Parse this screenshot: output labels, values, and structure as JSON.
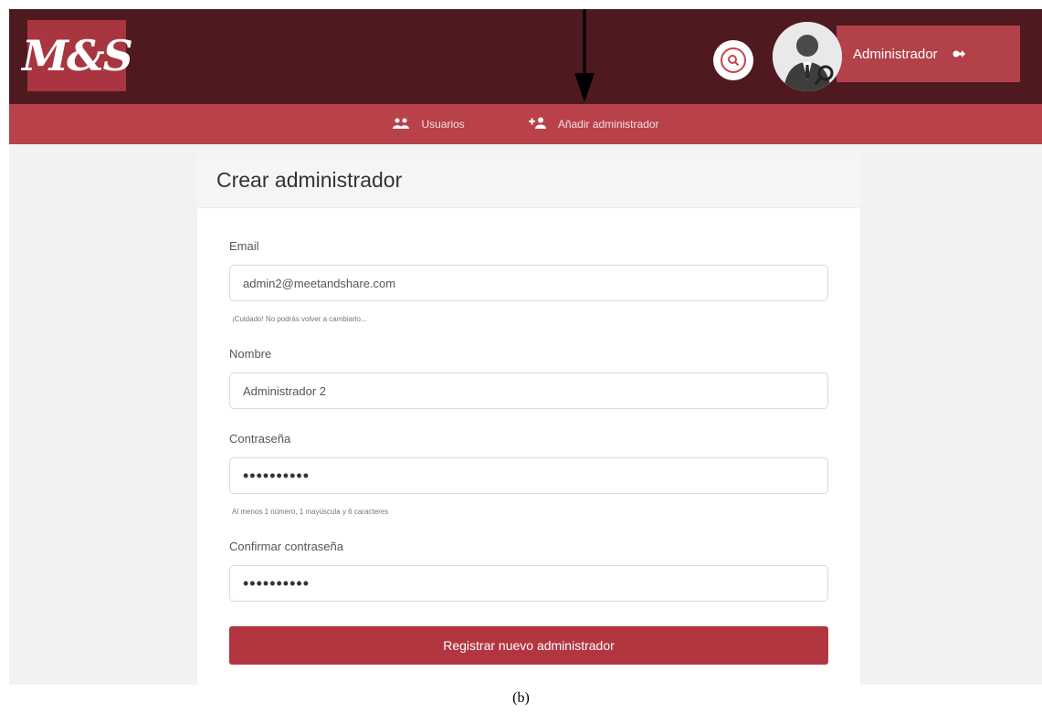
{
  "header": {
    "logo_text": "M&S",
    "user_label": "Administrador",
    "icons": [
      "search-icon",
      "avatar",
      "logout-icon"
    ]
  },
  "nav": {
    "items": [
      {
        "label": "Usuarios",
        "icon": "users-icon"
      },
      {
        "label": "Añadir administrador",
        "icon": "add-user-icon"
      }
    ]
  },
  "form": {
    "title": "Crear administrador",
    "email": {
      "label": "Email",
      "value": "admin2@meetandshare.com",
      "hint": "¡Cuidado! No podrás volver a cambiarlo..."
    },
    "nombre": {
      "label": "Nombre",
      "value": "Administrador 2"
    },
    "password": {
      "label": "Contraseña",
      "value": "••••••••••",
      "hint": "Al menos 1 número, 1 mayúscula y 6 caracteres"
    },
    "confirm": {
      "label": "Confirmar contraseña",
      "value": "••••••••••"
    },
    "submit_label": "Registrar nuevo administrador"
  },
  "caption": "(b)",
  "colors": {
    "header_bg": "#4f1920",
    "nav_bg": "#b8414a",
    "accent": "#b3353f"
  }
}
